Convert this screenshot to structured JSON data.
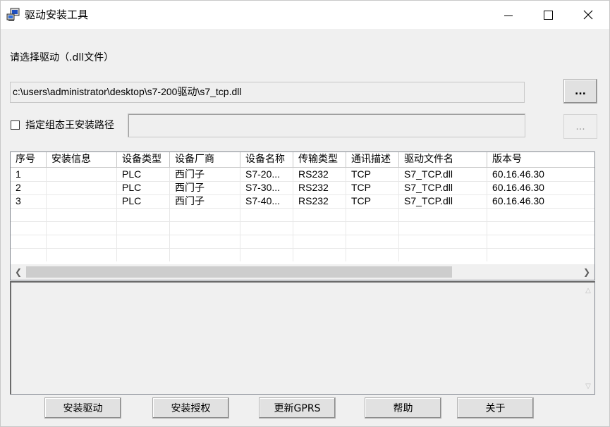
{
  "window": {
    "title": "驱动安装工具",
    "icon": "computer-tool-icon"
  },
  "driver_select": {
    "label": "请选择驱动（.dll文件）",
    "path_value": "c:\\users\\administrator\\desktop\\s7-200驱动\\s7_tcp.dll",
    "browse_label": "..."
  },
  "install_path": {
    "checkbox_label": "指定组态王安装路径",
    "checked": false,
    "value": "",
    "browse_label": "..."
  },
  "table": {
    "columns": [
      "序号",
      "安装信息",
      "设备类型",
      "设备厂商",
      "设备名称",
      "传输类型",
      "通讯描述",
      "驱动文件名",
      "版本号"
    ],
    "rows": [
      [
        "1",
        "",
        "PLC",
        "西门子",
        "S7-20...",
        "RS232",
        "TCP",
        "S7_TCP.dll",
        "60.16.46.30"
      ],
      [
        "2",
        "",
        "PLC",
        "西门子",
        "S7-30...",
        "RS232",
        "TCP",
        "S7_TCP.dll",
        "60.16.46.30"
      ],
      [
        "3",
        "",
        "PLC",
        "西门子",
        "S7-40...",
        "RS232",
        "TCP",
        "S7_TCP.dll",
        "60.16.46.30"
      ]
    ]
  },
  "log": {
    "text": ""
  },
  "buttons": {
    "install_driver": "安装驱动",
    "install_license": "安装授权",
    "update_gprs": "更新GPRS",
    "help": "帮助",
    "about": "关于"
  }
}
